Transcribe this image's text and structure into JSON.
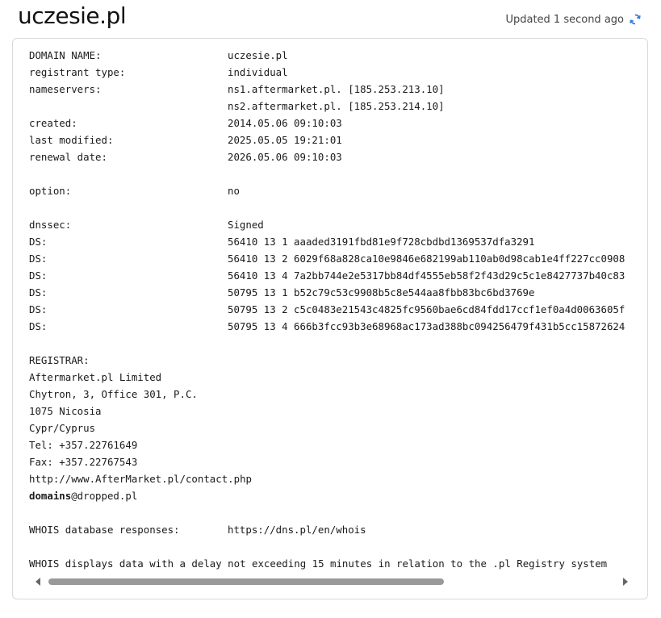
{
  "header": {
    "domain_title": "uczesie.pl",
    "updated_text": "Updated 1 second ago",
    "refresh_icon": "refresh-icon",
    "refresh_color": "#3a7bd5"
  },
  "whois": {
    "domain_name": {
      "key": "DOMAIN NAME:",
      "value": "uczesie.pl"
    },
    "registrant_type": {
      "key": "registrant type:",
      "value": "individual"
    },
    "nameservers": {
      "key": "nameservers:",
      "values": [
        "ns1.aftermarket.pl. [185.253.213.10]",
        "ns2.aftermarket.pl. [185.253.214.10]"
      ]
    },
    "created": {
      "key": "created:",
      "value": "2014.05.06 09:10:03"
    },
    "last_modified": {
      "key": "last modified:",
      "value": "2025.05.05 19:21:01"
    },
    "renewal_date": {
      "key": "renewal date:",
      "value": "2026.05.06 09:10:03"
    },
    "option": {
      "key": "option:",
      "value": "no"
    },
    "dnssec": {
      "key": "dnssec:",
      "value": "Signed"
    },
    "ds_records": [
      {
        "key": "DS:",
        "value": "56410 13 1 aaaded3191fbd81e9f728cbdbd1369537dfa3291"
      },
      {
        "key": "DS:",
        "value": "56410 13 2 6029f68a828ca10e9846e682199ab110ab0d98cab1e4ff227cc0908"
      },
      {
        "key": "DS:",
        "value": "56410 13 4 7a2bb744e2e5317bb84df4555eb58f2f43d29c5c1e8427737b40c83"
      },
      {
        "key": "DS:",
        "value": "50795 13 1 b52c79c53c9908b5c8e544aa8fbb83bc6bd3769e"
      },
      {
        "key": "DS:",
        "value": "50795 13 2 c5c0483e21543c4825fc9560bae6cd84fdd17ccf1ef0a4d0063605f"
      },
      {
        "key": "DS:",
        "value": "50795 13 4 666b3fcc93b3e68968ac173ad388bc094256479f431b5cc15872624"
      }
    ],
    "registrar": {
      "heading": "REGISTRAR:",
      "name": "Aftermarket.pl Limited",
      "address1": "Chytron, 3, Office 301, P.C.",
      "address2": "1075 Nicosia",
      "country": "Cypr/Cyprus",
      "tel": "Tel: +357.22761649",
      "fax": "Fax: +357.22767543",
      "url": "http://www.AfterMarket.pl/contact.php",
      "email_user": "domains",
      "email_domain": "@dropped.pl"
    },
    "whois_responses": {
      "key": "WHOIS database responses:",
      "value": "https://dns.pl/en/whois"
    },
    "footer_note": "WHOIS displays data with a delay not exceeding 15 minutes in relation to the .pl Registry system"
  }
}
